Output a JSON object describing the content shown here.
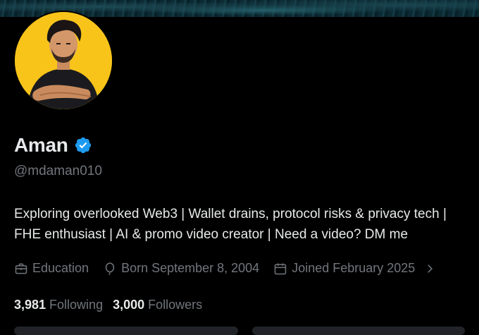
{
  "profile": {
    "name": "Aman",
    "handle": "@mdaman010",
    "bio": "Exploring overlooked Web3 | Wallet drains, protocol risks & privacy tech | FHE enthusiast | AI & promo video creator | Need a video? DM me",
    "verified": true,
    "avatar_bg": "#f8c41a"
  },
  "meta": {
    "category": "Education",
    "category_icon": "briefcase-icon",
    "birthday": "Born September 8, 2004",
    "birthday_icon": "balloon-icon",
    "joined": "Joined February 2025",
    "joined_icon": "calendar-icon"
  },
  "stats": {
    "following_count": "3,981",
    "following_label": "Following",
    "followers_count": "3,000",
    "followers_label": "Followers"
  },
  "colors": {
    "background": "#000000",
    "text_primary": "#e7e9ea",
    "text_secondary": "#71767b",
    "verified_blue": "#1d9bf0"
  }
}
